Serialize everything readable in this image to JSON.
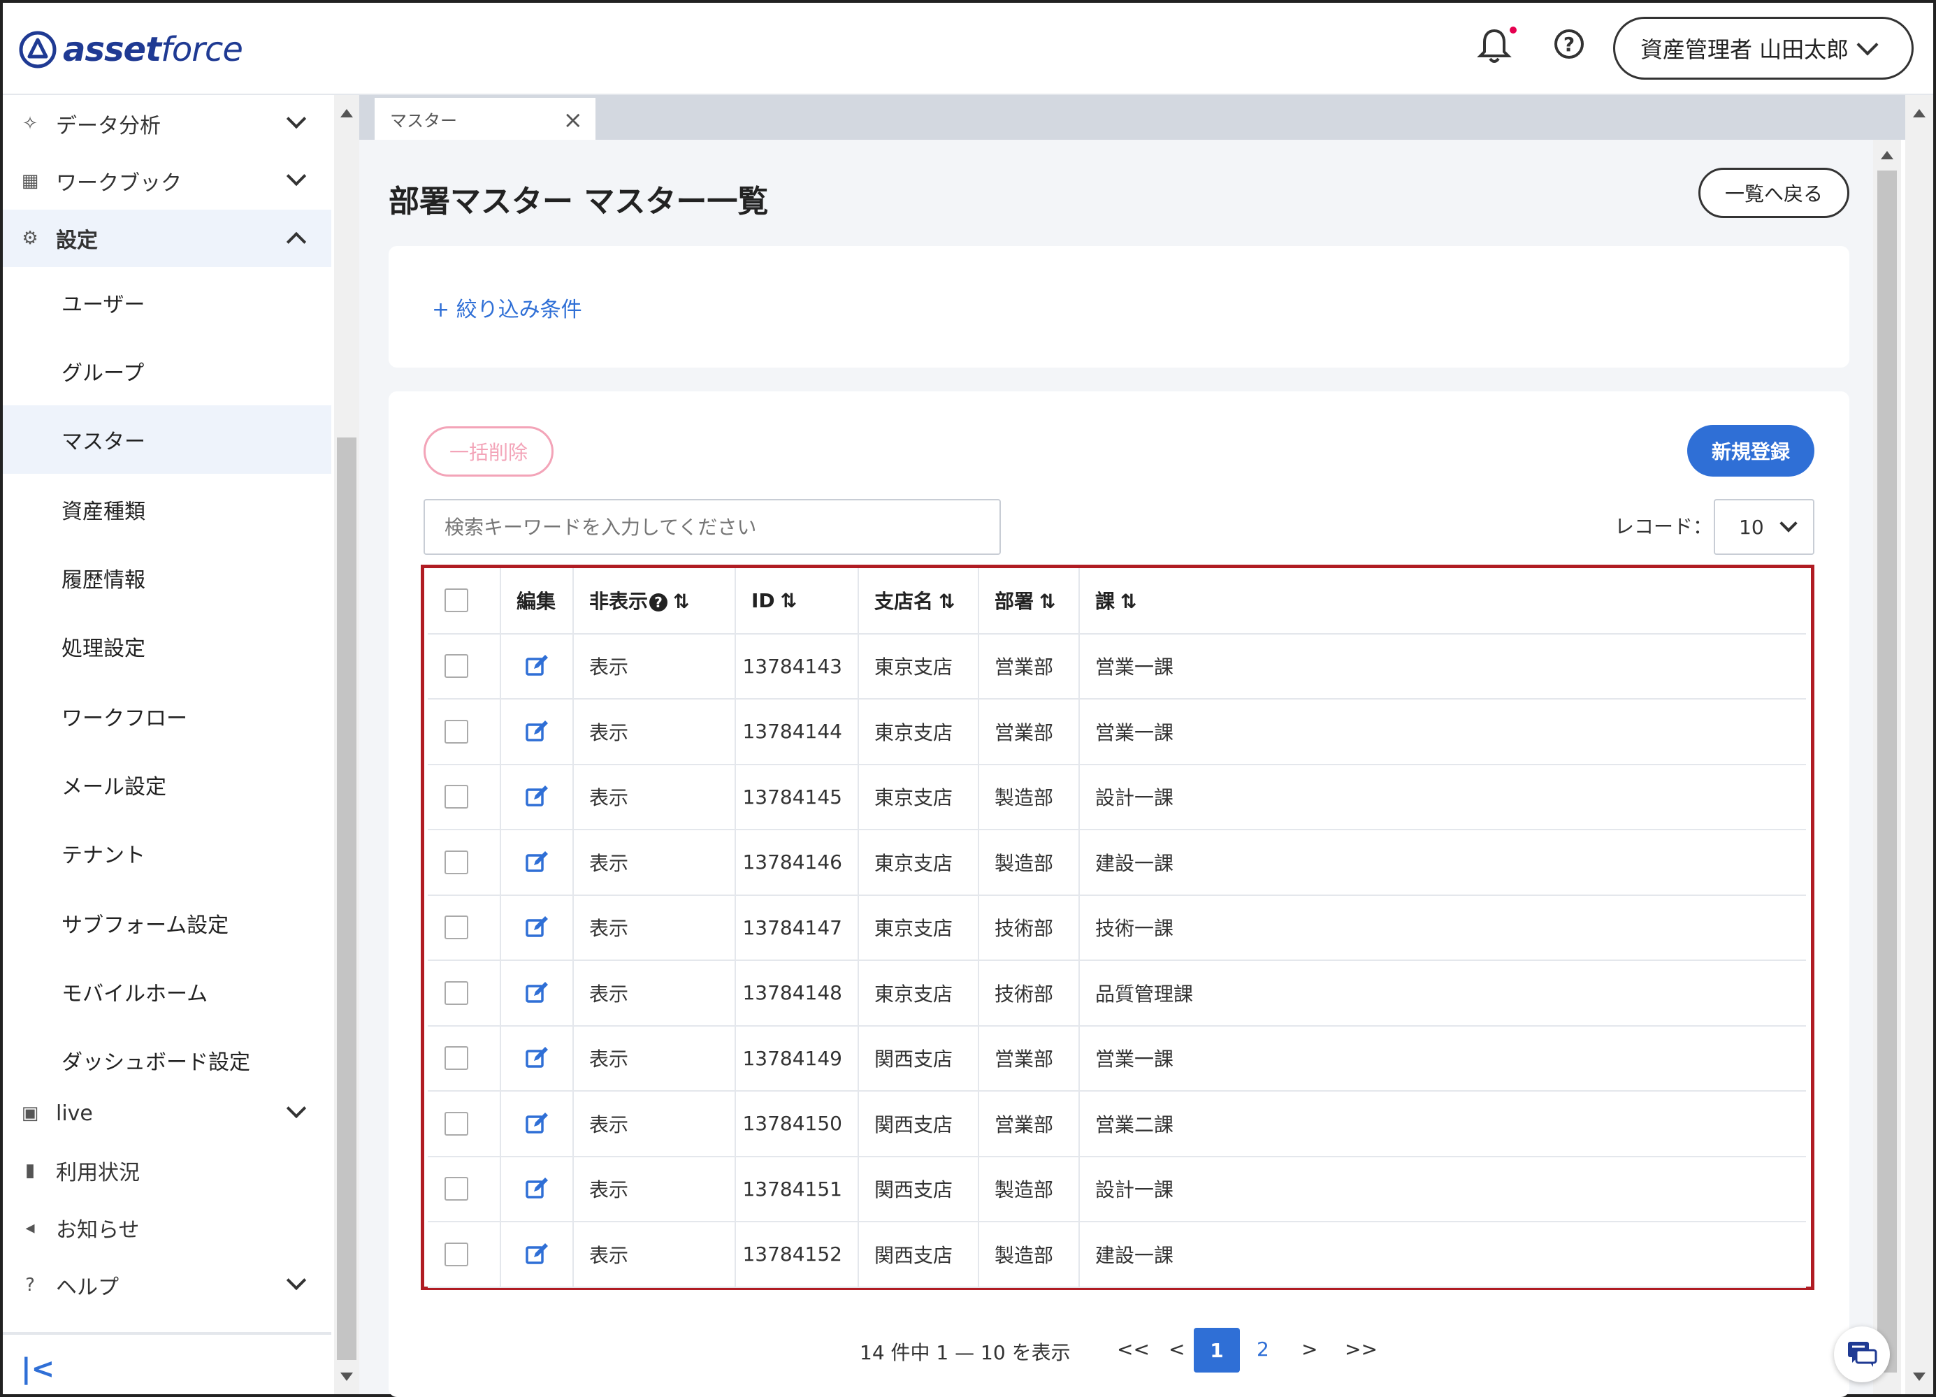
{
  "app": {
    "logo_bold": "asset",
    "logo_light": "force"
  },
  "header": {
    "user_label": "資産管理者 山田太郎"
  },
  "sidebar": {
    "sections": [
      {
        "label": "データ分析"
      },
      {
        "label": "ワークブック"
      },
      {
        "label": "設定"
      }
    ],
    "settings_items": [
      {
        "label": "ユーザー"
      },
      {
        "label": "グループ"
      },
      {
        "label": "マスター"
      },
      {
        "label": "資産種類"
      },
      {
        "label": "履歴情報"
      },
      {
        "label": "処理設定"
      },
      {
        "label": "ワークフロー"
      },
      {
        "label": "メール設定"
      },
      {
        "label": "テナント"
      },
      {
        "label": "サブフォーム設定"
      },
      {
        "label": "モバイルホーム"
      },
      {
        "label": "ダッシュボード設定"
      }
    ],
    "bottom_sections": [
      {
        "label": "live"
      },
      {
        "label": "利用状況"
      },
      {
        "label": "お知らせ"
      },
      {
        "label": "ヘルプ"
      }
    ],
    "collapse_glyph": "|<"
  },
  "tabs": [
    {
      "label": "マスター"
    }
  ],
  "page": {
    "title": "部署マスター マスター一覧",
    "back_label": "一覧へ戻る"
  },
  "filter": {
    "label": "+ 絞り込み条件"
  },
  "toolbar": {
    "bulk_delete_label": "一括削除",
    "new_label": "新規登録",
    "search_placeholder": "検索キーワードを入力してください",
    "record_label": "レコード：",
    "record_value": "10"
  },
  "table": {
    "headers": {
      "edit": "編集",
      "hidden": "非表示",
      "id": "ID",
      "branch": "支店名",
      "dept": "部署",
      "section": "課"
    },
    "rows": [
      {
        "hidden": "表示",
        "id": "13784143",
        "branch": "東京支店",
        "dept": "営業部",
        "section": "営業一課"
      },
      {
        "hidden": "表示",
        "id": "13784144",
        "branch": "東京支店",
        "dept": "営業部",
        "section": "営業一課"
      },
      {
        "hidden": "表示",
        "id": "13784145",
        "branch": "東京支店",
        "dept": "製造部",
        "section": "設計一課"
      },
      {
        "hidden": "表示",
        "id": "13784146",
        "branch": "東京支店",
        "dept": "製造部",
        "section": "建設一課"
      },
      {
        "hidden": "表示",
        "id": "13784147",
        "branch": "東京支店",
        "dept": "技術部",
        "section": "技術一課"
      },
      {
        "hidden": "表示",
        "id": "13784148",
        "branch": "東京支店",
        "dept": "技術部",
        "section": "品質管理課"
      },
      {
        "hidden": "表示",
        "id": "13784149",
        "branch": "関西支店",
        "dept": "営業部",
        "section": "営業一課"
      },
      {
        "hidden": "表示",
        "id": "13784150",
        "branch": "関西支店",
        "dept": "営業部",
        "section": "営業二課"
      },
      {
        "hidden": "表示",
        "id": "13784151",
        "branch": "関西支店",
        "dept": "製造部",
        "section": "設計一課"
      },
      {
        "hidden": "表示",
        "id": "13784152",
        "branch": "関西支店",
        "dept": "製造部",
        "section": "建設一課"
      }
    ]
  },
  "pagination": {
    "info": "14 件中 1 — 10 を表示",
    "first": "<<",
    "prev": "<",
    "next": ">",
    "last": ">>",
    "pages": [
      "1",
      "2"
    ],
    "current": "1"
  },
  "colors": {
    "accent": "#2f6fd6",
    "highlight_border": "#b01c23",
    "danger_light": "#f3a4b8"
  }
}
